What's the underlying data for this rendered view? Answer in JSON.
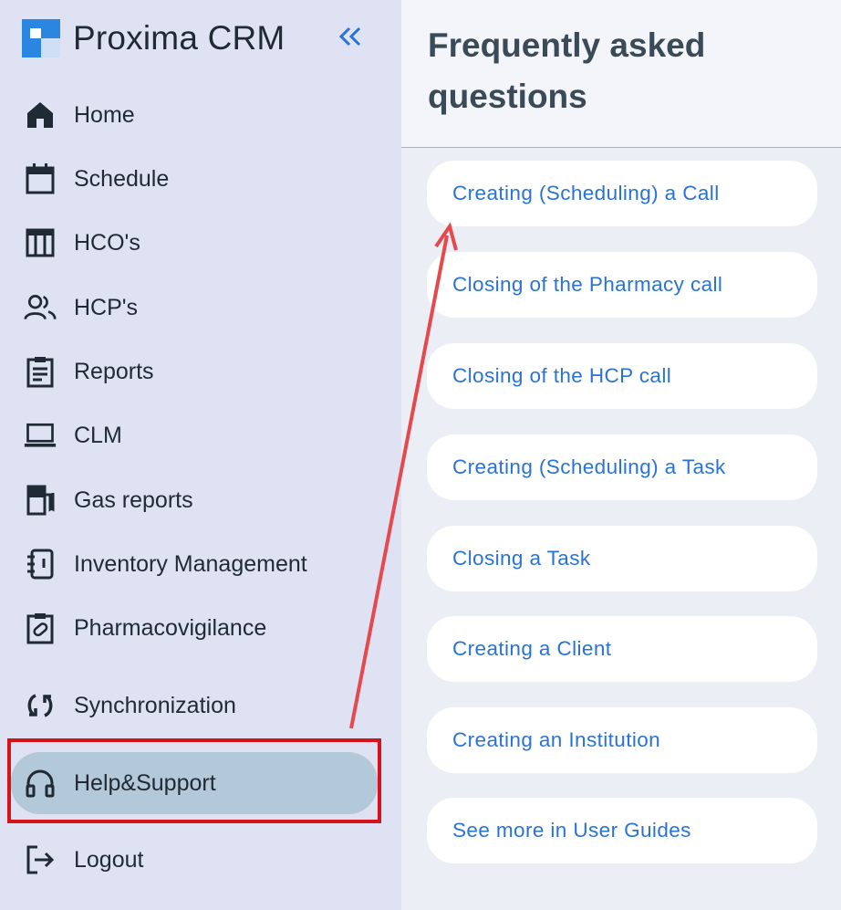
{
  "app": {
    "name": "Proxima CRM",
    "collapse_icon": "double-chevron-left-icon"
  },
  "sidebar": {
    "items": [
      {
        "label": "Home",
        "icon": "home-icon"
      },
      {
        "label": "Schedule",
        "icon": "calendar-icon"
      },
      {
        "label": "HCO's",
        "icon": "building-icon"
      },
      {
        "label": "HCP's",
        "icon": "people-icon"
      },
      {
        "label": "Reports",
        "icon": "clipboard-icon"
      },
      {
        "label": "CLM",
        "icon": "laptop-icon"
      },
      {
        "label": "Gas reports",
        "icon": "gas-pump-icon"
      },
      {
        "label": "Inventory Management",
        "icon": "notebook-icon"
      },
      {
        "label": "Pharmacovigilance",
        "icon": "pill-clipboard-icon"
      },
      {
        "label": "Synchronization",
        "icon": "sync-icon"
      },
      {
        "label": "Help&Support",
        "icon": "headset-icon",
        "active": true
      },
      {
        "label": "Logout",
        "icon": "logout-icon"
      }
    ]
  },
  "main": {
    "title": "Frequently asked questions",
    "faq": [
      "Creating (Scheduling) a Call",
      "Closing of the Pharmacy call",
      "Closing of the HCP call",
      "Creating (Scheduling) a Task",
      "Closing a Task",
      "Creating a Client",
      "Creating an Institution",
      "See more in User Guides"
    ]
  },
  "colors": {
    "accent": "#2a73d6",
    "sidebar_bg": "#dfe2f3",
    "active_bg": "#b3c8d8",
    "annotation_red": "#d6121b"
  }
}
